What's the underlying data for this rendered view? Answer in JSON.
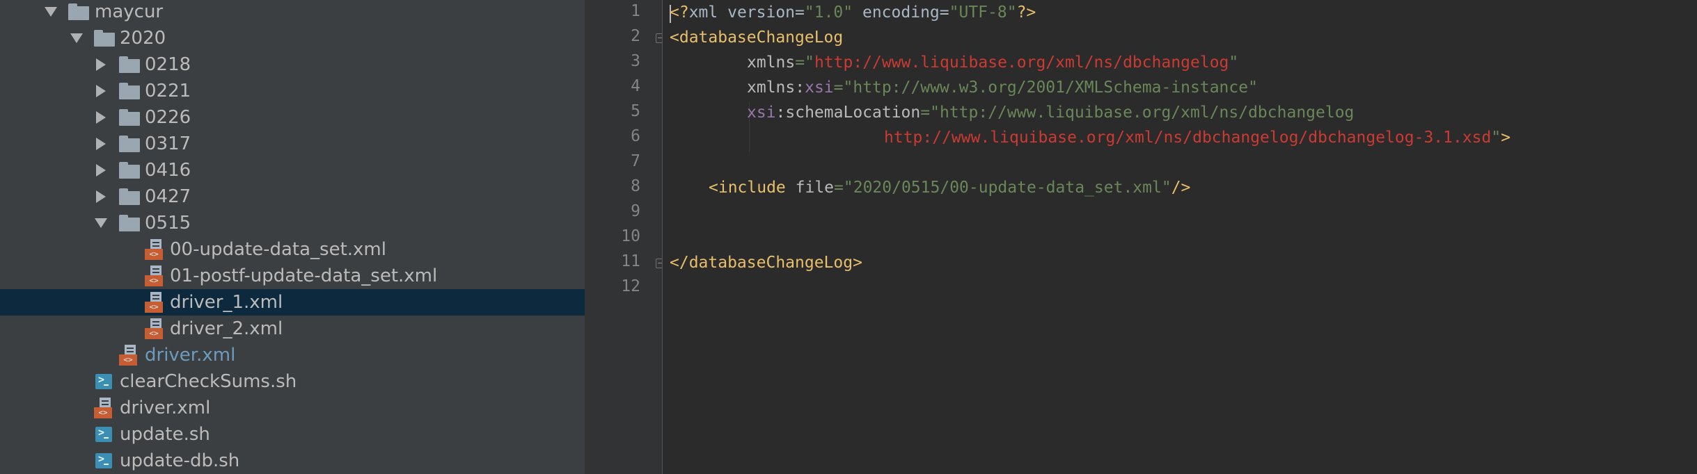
{
  "project_tree": {
    "items": [
      {
        "label": "maycur",
        "type": "folder",
        "expanded": true
      },
      {
        "label": "2020",
        "type": "folder",
        "expanded": true
      },
      {
        "label": "0218",
        "type": "folder",
        "expanded": false
      },
      {
        "label": "0221",
        "type": "folder",
        "expanded": false
      },
      {
        "label": "0226",
        "type": "folder",
        "expanded": false
      },
      {
        "label": "0317",
        "type": "folder",
        "expanded": false
      },
      {
        "label": "0416",
        "type": "folder",
        "expanded": false
      },
      {
        "label": "0427",
        "type": "folder",
        "expanded": false
      },
      {
        "label": "0515",
        "type": "folder",
        "expanded": true
      },
      {
        "label": "00-update-data_set.xml",
        "type": "xml-file"
      },
      {
        "label": "01-postf-update-data_set.xml",
        "type": "xml-file"
      },
      {
        "label": "driver_1.xml",
        "type": "xml-file",
        "selected": true
      },
      {
        "label": "driver_2.xml",
        "type": "xml-file"
      },
      {
        "label": "driver.xml",
        "type": "xml-file",
        "modified": true
      },
      {
        "label": "clearCheckSums.sh",
        "type": "shell-file"
      },
      {
        "label": "driver.xml",
        "type": "xml-file"
      },
      {
        "label": "update.sh",
        "type": "shell-file"
      },
      {
        "label": "update-db.sh",
        "type": "shell-file"
      }
    ]
  },
  "editor": {
    "line_numbers": [
      "1",
      "2",
      "3",
      "4",
      "5",
      "6",
      "7",
      "8",
      "9",
      "10",
      "11",
      "12"
    ],
    "lines": {
      "l1": {
        "p1": "<?",
        "p2": "xml ",
        "p3": "version",
        "p4": "=",
        "p5": "\"1.0\"",
        "p6": " encoding",
        "p7": "=",
        "p8": "\"UTF-8\"",
        "p9": "?>"
      },
      "l2": {
        "p1": "<databaseChangeLog"
      },
      "l3": {
        "p1": "xmlns",
        "p2": "=",
        "p3": "\"",
        "p4": "http://www.liquibase.org/xml/ns/dbchangelog",
        "p5": "\""
      },
      "l4": {
        "p1": "xmlns",
        "p2": ":",
        "p3": "xsi",
        "p4": "=",
        "p5": "\"http://www.w3.org/2001/XMLSchema-instance\""
      },
      "l5": {
        "p1": "xsi",
        "p2": ":schemaLocation",
        "p3": "=",
        "p4": "\"http://www.liquibase.org/xml/ns/dbchangelog"
      },
      "l6": {
        "p1": "http://www.liquibase.org/xml/ns/dbchangelog/dbchangelog-3.1.xsd",
        "p2": "\"",
        "p3": ">"
      },
      "l8": {
        "p1": "<include ",
        "p2": "file",
        "p3": "=",
        "p4": "\"2020/0515/00-update-data_set.xml\"",
        "p5": "/>"
      },
      "l11": {
        "p1": "</databaseChangeLog>"
      }
    }
  },
  "colors": {
    "tree_bg": "#3c3f41",
    "selection": "#0d293e",
    "editor_bg": "#2b2b2b",
    "tag": "#e8bf6a",
    "string": "#6a8759",
    "namespace": "#9876aa",
    "url": "#cc3a32"
  }
}
